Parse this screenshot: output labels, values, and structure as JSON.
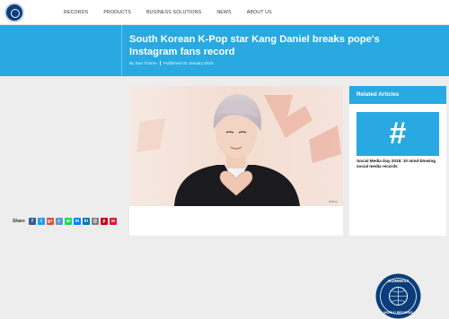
{
  "nav": {
    "items": [
      "RECORDS",
      "PRODUCTS",
      "BUSINESS SOLUTIONS",
      "NEWS",
      "ABOUT US"
    ]
  },
  "article": {
    "title": "South Korean K-Pop star Kang Daniel breaks pope's Instagram fans record",
    "author": "By Dan Thorne",
    "published": "Published 03 January 2019",
    "photo_credit": "Alamy"
  },
  "share": {
    "label": "Share",
    "icons": [
      {
        "name": "facebook-icon",
        "glyph": "f",
        "color": "#3b5998"
      },
      {
        "name": "twitter-icon",
        "glyph": "t",
        "color": "#1da1f2"
      },
      {
        "name": "google-plus-icon",
        "glyph": "g+",
        "color": "#dd4b39"
      },
      {
        "name": "reddit-icon",
        "glyph": "r",
        "color": "#5f99cf"
      },
      {
        "name": "whatsapp-icon",
        "glyph": "w",
        "color": "#25d366"
      },
      {
        "name": "messenger-icon",
        "glyph": "m",
        "color": "#0084ff"
      },
      {
        "name": "linkedin-icon",
        "glyph": "in",
        "color": "#0077b5"
      },
      {
        "name": "email-icon",
        "glyph": "@",
        "color": "#7d7d7d"
      },
      {
        "name": "pinterest-icon",
        "glyph": "p",
        "color": "#bd081c"
      },
      {
        "name": "weibo-icon",
        "glyph": "w",
        "color": "#e6162d"
      }
    ]
  },
  "sidebar": {
    "heading": "Related Articles",
    "related_caption": "Social Media Day 2018: 10 mind-blowing social media records",
    "badge_text_top": "GUINNESS",
    "badge_text_bottom": "WORLD RECORDS"
  },
  "colors": {
    "brand_blue": "#29a9e1",
    "navy": "#0a3d7a"
  }
}
